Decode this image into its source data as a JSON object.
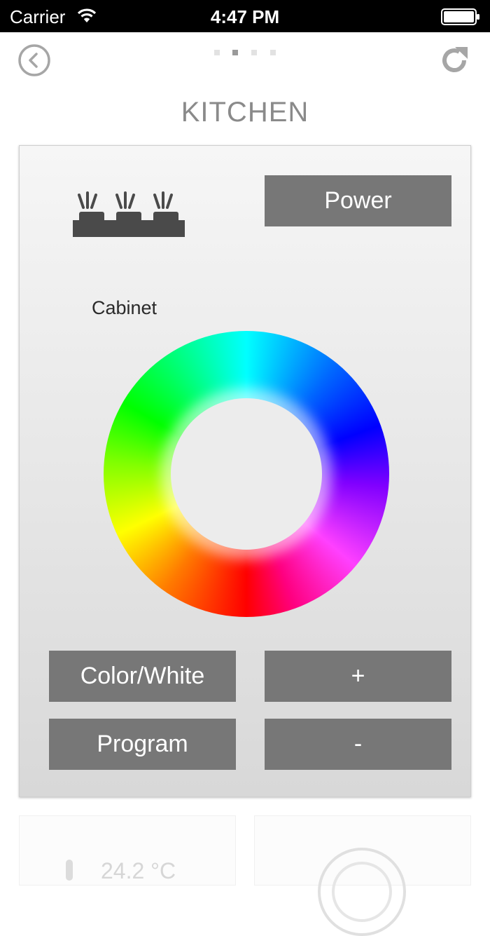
{
  "status_bar": {
    "carrier": "Carrier",
    "time": "4:47 PM"
  },
  "nav": {
    "back_icon": "back-circle-icon",
    "refresh_icon": "refresh-icon",
    "page_count": 4,
    "active_page": 2
  },
  "room": {
    "title": "KITCHEN"
  },
  "zone": {
    "label": "Cabinet",
    "icon": "cabinet-lights-icon",
    "power_label": "Power",
    "color_white_label": "Color/White",
    "plus_label": "+",
    "program_label": "Program",
    "minus_label": "-"
  },
  "next_cards": {
    "temperature": "24.2 °C"
  }
}
